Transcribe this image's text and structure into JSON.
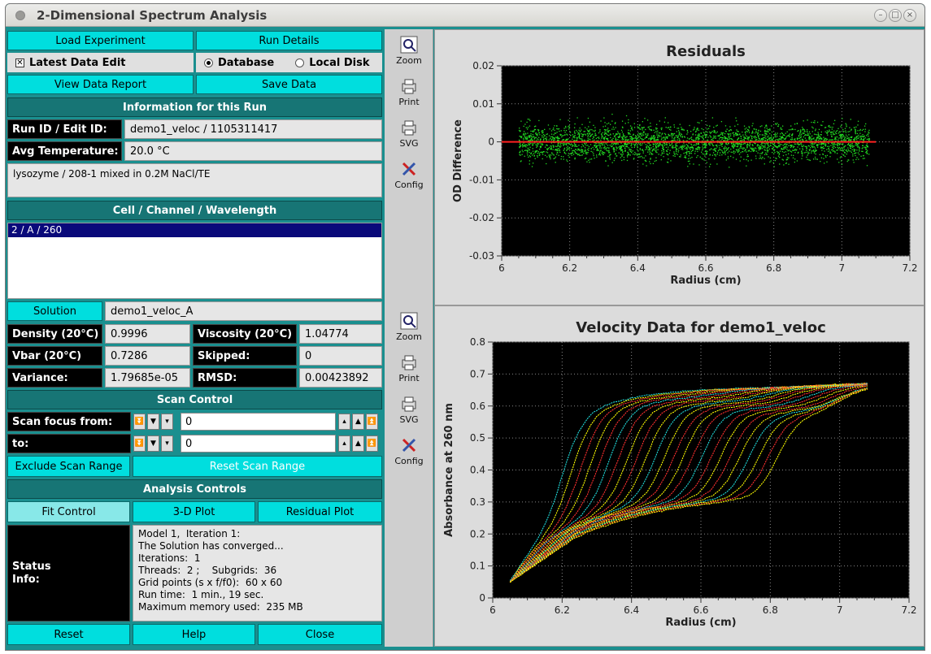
{
  "window": {
    "title": "2-Dimensional Spectrum Analysis"
  },
  "buttons": {
    "load_experiment": "Load Experiment",
    "run_details": "Run Details",
    "view_data_report": "View Data Report",
    "save_data": "Save Data",
    "solution": "Solution",
    "exclude_scan": "Exclude Scan Range",
    "reset_scan": "Reset Scan Range",
    "fit_control": "Fit Control",
    "plot_3d": "3-D Plot",
    "residual_plot": "Residual Plot",
    "reset": "Reset",
    "help": "Help",
    "close": "Close"
  },
  "options": {
    "latest_edit": "Latest Data Edit",
    "database": "Database",
    "local_disk": "Local Disk"
  },
  "headers": {
    "run_info": "Information for this Run",
    "cell": "Cell / Channel / Wavelength",
    "scan_control": "Scan Control",
    "analysis": "Analysis Controls"
  },
  "run": {
    "id_label": "Run ID / Edit ID:",
    "id_value": "demo1_veloc / 1105311417",
    "temp_label": "Avg Temperature:",
    "temp_value": "20.0 °C",
    "description": "lysozyme / 208-1 mixed in 0.2M NaCl/TE",
    "cell_item": "2 / A / 260"
  },
  "solution": {
    "value": "demo1_veloc_A",
    "density_label": "Density (20°C)",
    "density": "0.9996",
    "viscosity_label": "Viscosity (20°C)",
    "viscosity": "1.04774",
    "vbar_label": "Vbar (20°C)",
    "vbar": "0.7286",
    "skipped_label": "Skipped:",
    "skipped": "0",
    "variance_label": "Variance:",
    "variance": "1.79685e-05",
    "rmsd_label": "RMSD:",
    "rmsd": "0.00423892"
  },
  "scan": {
    "from_label": "Scan focus from:",
    "from_value": "0",
    "to_label": "to:",
    "to_value": "0"
  },
  "status": {
    "label": "Status\nInfo:",
    "text": "Model 1,  Iteration 1:\nThe Solution has converged...\nIterations:  1\nThreads:  2 ;    Subgrids:  36\nGrid points (s x f/f0):  60 x 60\nRun time:  1 min., 19 sec.\nMaximum memory used:  235 MB"
  },
  "tools": {
    "zoom": "Zoom",
    "print": "Print",
    "svg": "SVG",
    "config": "Config"
  },
  "chart_data": [
    {
      "type": "scatter",
      "title": "Residuals",
      "xlabel": "Radius (cm)",
      "ylabel": "OD Difference",
      "xlim": [
        6,
        7.2
      ],
      "ylim": [
        -0.03,
        0.02
      ],
      "xticks": [
        "6",
        "6.2",
        "6.4",
        "6.6",
        "6.8",
        "7",
        "7.2"
      ],
      "yticks": [
        "0.02",
        "0.01",
        "0",
        "-0.01",
        "-0.02",
        "-0.03"
      ],
      "data_x_range": [
        6.05,
        7.08
      ],
      "spread": 0.008,
      "zero_line": {
        "x": [
          6.0,
          7.1
        ],
        "y": 0,
        "color": "#ff2020"
      },
      "point_color": "#22dd22",
      "grid": true
    },
    {
      "type": "line",
      "title": "Velocity Data for demo1_veloc",
      "xlabel": "Radius (cm)",
      "ylabel": "Absorbance at 260 nm",
      "xlim": [
        6,
        7.2
      ],
      "ylim": [
        0,
        0.8
      ],
      "xticks": [
        "6",
        "6.2",
        "6.4",
        "6.6",
        "6.8",
        "7",
        "7.2"
      ],
      "yticks": [
        "0.8",
        "0.7",
        "0.6",
        "0.5",
        "0.4",
        "0.3",
        "0.2",
        "0.1",
        "0"
      ],
      "meniscus": 6.05,
      "bottom": 7.08,
      "plateau": 0.7,
      "scan_count": 24,
      "colors": [
        "#ffff00",
        "#ff3030",
        "#20dddd"
      ],
      "grid": true
    }
  ]
}
